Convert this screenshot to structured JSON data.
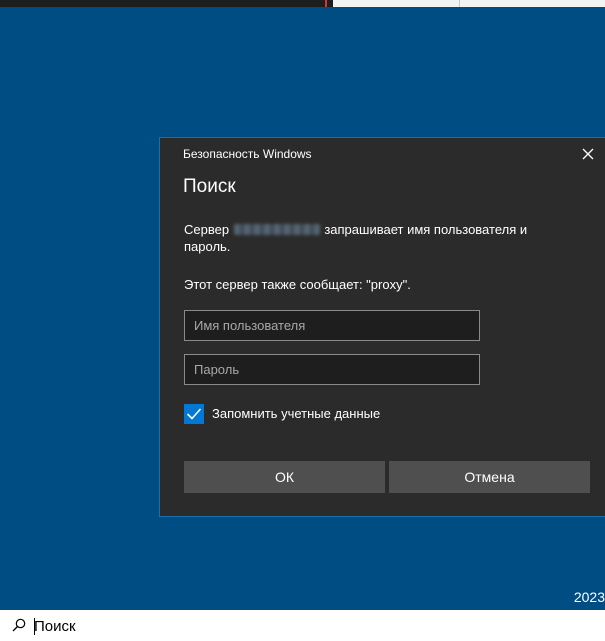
{
  "dialog": {
    "caption": "Безопасность Windows",
    "title": "Поиск",
    "message_prefix": "Сервер",
    "message_suffix": "запрашивает имя пользователя и пароль.",
    "server_message": "Этот сервер также сообщает: \"proxy\".",
    "username_placeholder": "Имя пользователя",
    "password_placeholder": "Пароль",
    "remember_label": "Запомнить учетные данные",
    "remember_checked": true,
    "ok_label": "ОК",
    "cancel_label": "Отмена"
  },
  "desktop": {
    "year_fragment": "2023"
  },
  "taskbar": {
    "search_placeholder": "Поиск"
  },
  "icons": {
    "close": "close-icon",
    "check": "check-icon",
    "search": "search-icon"
  },
  "colors": {
    "desktop_background": "#004d84",
    "dialog_background": "#2b2b2b",
    "accent": "#0078d4",
    "button": "#4f4f4f"
  }
}
